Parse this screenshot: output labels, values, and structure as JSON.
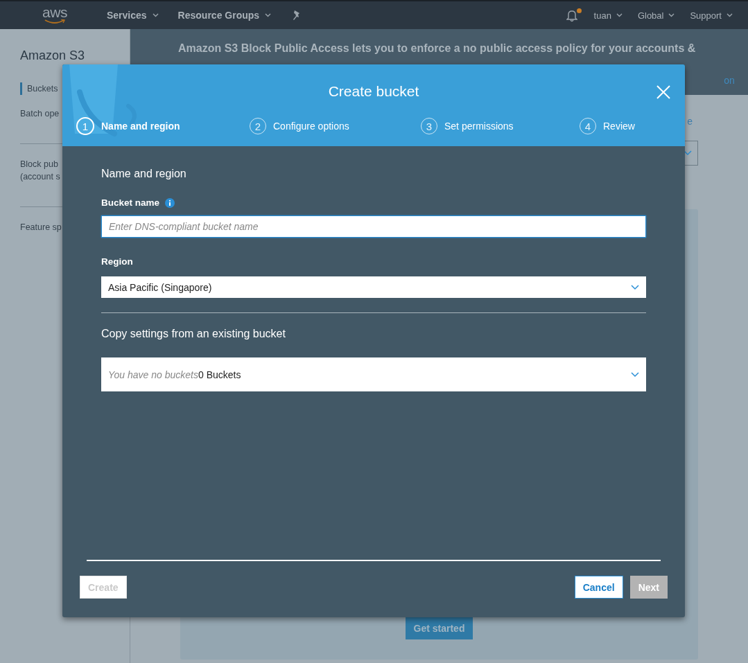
{
  "nav": {
    "logo": "aws",
    "menus": [
      {
        "label": "Services"
      },
      {
        "label": "Resource Groups"
      }
    ],
    "right_menus": [
      {
        "label": "tuan"
      },
      {
        "label": "Global"
      },
      {
        "label": "Support"
      }
    ],
    "notification": true
  },
  "sidebar": {
    "title": "Amazon S3",
    "groups": [
      {
        "items": [
          {
            "lines": [
              "Buckets"
            ],
            "selected": true
          },
          {
            "lines": [
              "Batch ope"
            ],
            "selected": false
          }
        ]
      },
      {
        "items": [
          {
            "lines": [
              "Block pub",
              "(account s"
            ],
            "selected": false
          }
        ]
      },
      {
        "items": [
          {
            "lines": [
              "Feature sp"
            ],
            "selected": false
          }
        ]
      }
    ]
  },
  "banner": {
    "text": "Amazon S3 Block Public Access lets you to enforce a no public access policy for your accounts &",
    "fragment": "on"
  },
  "page": {
    "fragment": "e",
    "get_started": "Get started"
  },
  "dialog": {
    "title": "Create bucket",
    "steps": [
      {
        "number": "1",
        "label": "Name and region",
        "selected": true
      },
      {
        "number": "2",
        "label": "Configure options",
        "selected": false
      },
      {
        "number": "3",
        "label": "Set permissions",
        "selected": false
      },
      {
        "number": "4",
        "label": "Review",
        "selected": false
      }
    ],
    "section_title": "Name and region",
    "bucket_name": {
      "label": "Bucket name",
      "placeholder": "Enter DNS-compliant bucket name"
    },
    "region": {
      "label": "Region",
      "value": "Asia Pacific (Singapore)"
    },
    "copy_title": "Copy settings from an existing bucket",
    "copy_select": {
      "hint": "You have no buckets",
      "count": "0 Buckets"
    },
    "buttons_left": [
      {
        "label": "Create",
        "kind": "secondary",
        "disabled": true
      }
    ],
    "buttons_right": [
      {
        "label": "Cancel",
        "kind": "secondary",
        "disabled": false
      },
      {
        "label": "Next",
        "kind": "primary",
        "disabled": true
      }
    ]
  }
}
